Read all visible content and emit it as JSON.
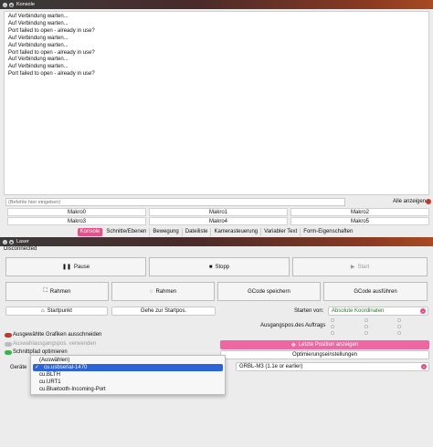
{
  "console_window": {
    "title": "Konsole",
    "output_lines": [
      "Auf Verbindung warten...",
      "Auf Verbindung warten...",
      "Port failed to open - already in use?",
      "Auf Verbindung warten...",
      "Auf Verbindung warten...",
      "Port failed to open - already in use?",
      "Auf Verbindung warten...",
      "Auf Verbindung warten...",
      "Port failed to open - already in use?"
    ],
    "command_placeholder": "(Befehle hier eingeben)",
    "show_all_label": "Alle anzeigen",
    "macros": [
      "Makro0",
      "Makro1",
      "Makro2",
      "Makro3",
      "Makro4",
      "Makro5"
    ]
  },
  "tabs": [
    "Konsole",
    "Schnitte/Ebenen",
    "Bewegung",
    "Dateiliste",
    "Kamerasteuerung",
    "Variabler Text",
    "Form-Eigenschaften"
  ],
  "laser_window": {
    "title": "Laser",
    "status": "Disconnected",
    "pause_label": "Pause",
    "stop_label": "Stopp",
    "start_label": "Start",
    "frame_label_1": "Rahmen",
    "frame_label_2": "Rahmen",
    "save_gcode_label": "GCode speichern",
    "run_gcode_label": "GCode ausführen",
    "startpoint_label": "Startpunkt",
    "goto_start_label": "Gehe zur Startpos.",
    "start_from_label": "Starten von:",
    "start_from_value": "Absolute Koordinaten",
    "job_origin_label": "Ausgangspos.des Auftrags",
    "cut_selected_label": "Ausgewählte Grafiken ausschneiden",
    "use_selection_origin_label": "Auswahlausgangspos. verwenden",
    "optimize_path_label": "Schnittpfad optimieren",
    "last_position_label": "Letzte Position anzeigen",
    "optimization_settings_label": "Optimierungseinstellungen",
    "devices_label": "Geräte",
    "device_value": "GRBL-M3 (1.1e or earlier)"
  },
  "port_dropdown": {
    "items": [
      "(Auswählen)",
      "cu.usbserial-1470",
      "cu.BLTH",
      "cu.URT1",
      "cu.Bluetooth-Incoming-Port"
    ],
    "selected": "cu.usbserial-1470",
    "check_mark": "✓"
  },
  "colors": {
    "accent": "#e84f8a",
    "selection": "#2c63d6",
    "toggle_on": "#3bb34a"
  }
}
